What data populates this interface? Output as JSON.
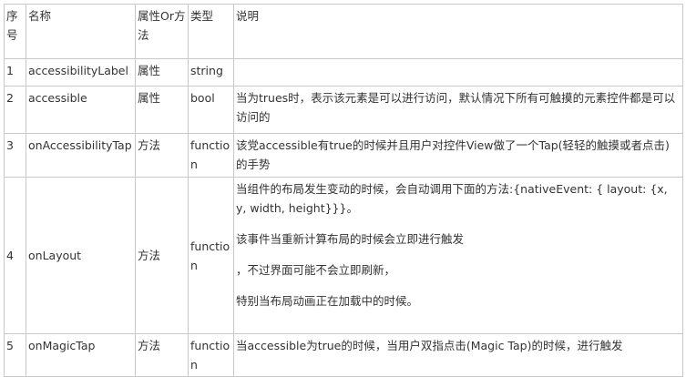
{
  "table": {
    "headers": [
      "序号",
      "名称",
      "属性Or方法",
      "类型",
      "说明"
    ],
    "rows": [
      {
        "no": "1",
        "name": "accessibilityLabel",
        "kind": "属性",
        "type": "string",
        "desc": []
      },
      {
        "no": "2",
        "name": "accessible",
        "kind": "属性",
        "type": "bool",
        "desc": [
          "当为trues时，表示该元素是可以进行访问，默认情况下所有可触摸的元素控件都是可以访问的"
        ]
      },
      {
        "no": "3",
        "name": "onAccessibilityTap",
        "kind": "方法",
        "type": "function",
        "desc": [
          "该党accessible有true的时候并且用户对控件View做了一个Tap(轻轻的触摸或者点击)的手势"
        ]
      },
      {
        "no": "4",
        "name": "onLayout",
        "kind": "方法",
        "type": "function",
        "desc": [
          "当组件的布局发生变动的时候，会自动调用下面的方法:{nativeEvent: { layout: {x, y, width, height}}}。",
          "该事件当重新计算布局的时候会立即进行触发",
          "，不过界面可能不会立即刷新，",
          "特别当布局动画正在加载中的时候。"
        ]
      },
      {
        "no": "5",
        "name": "onMagicTap",
        "kind": "方法",
        "type": "function",
        "desc": [
          "当accessible为true的时候，当用户双指点击(Magic Tap)的时候，进行触发"
        ]
      }
    ]
  }
}
